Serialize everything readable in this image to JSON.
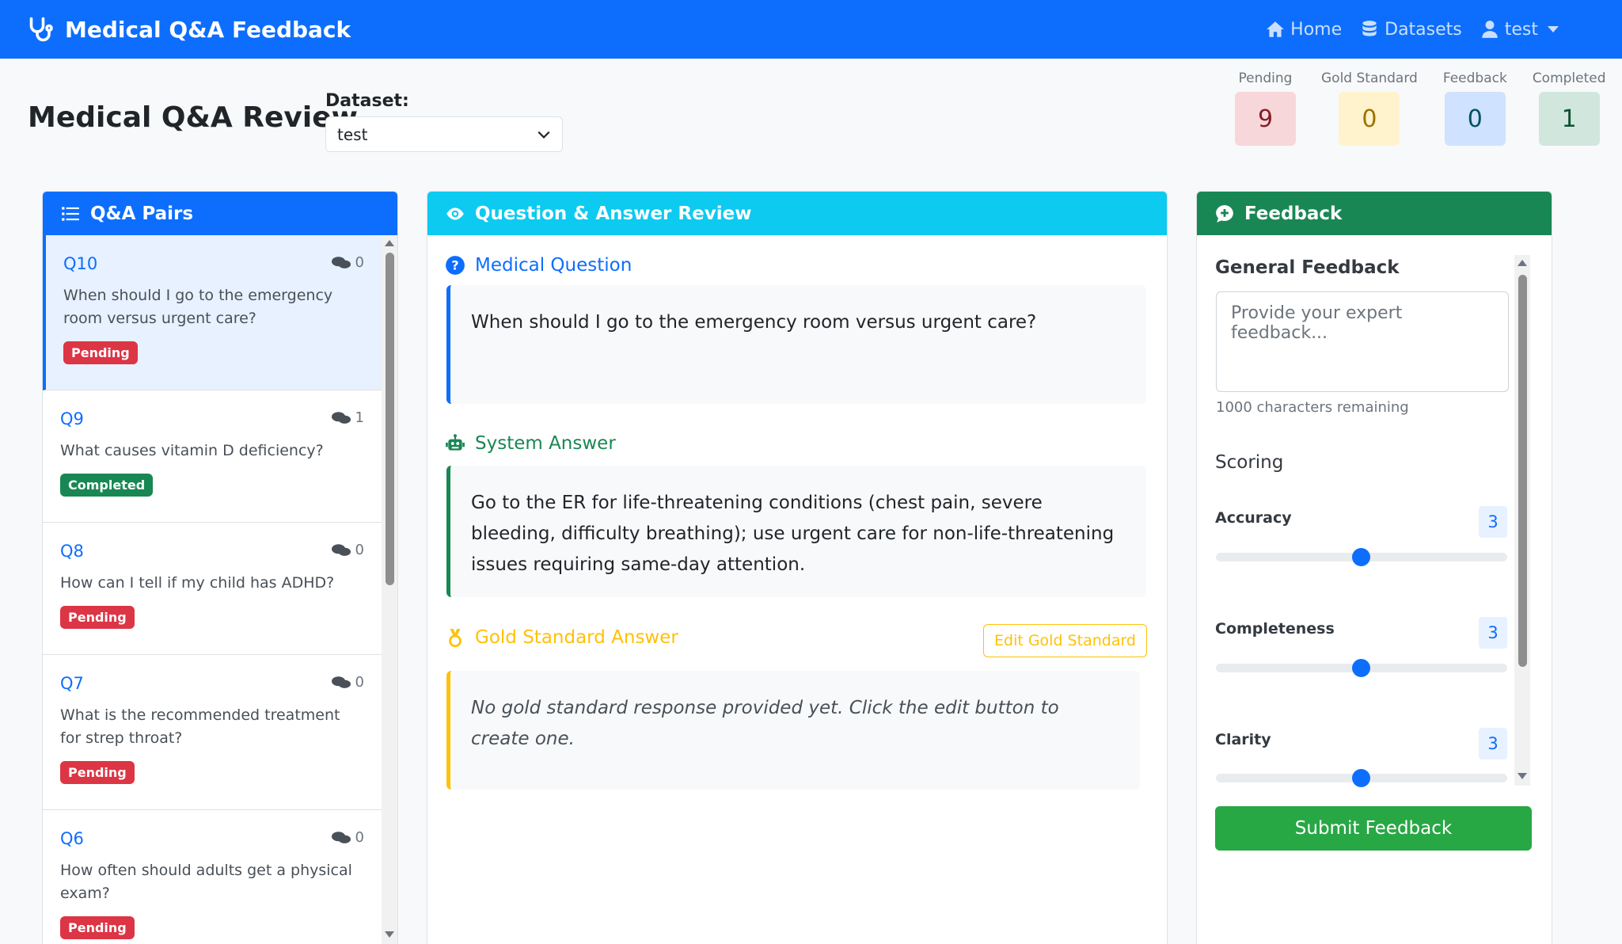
{
  "navbar": {
    "brand": "Medical Q&A Feedback",
    "home": "Home",
    "datasets": "Datasets",
    "user": "test",
    "bg_color": "#0d6efd"
  },
  "header": {
    "title": "Medical Q&A Review",
    "dataset_label": "Dataset:",
    "dataset_value": "test"
  },
  "stats": [
    {
      "label": "Pending",
      "value": "9",
      "bg": "#f8d7da",
      "fg": "#842029"
    },
    {
      "label": "Gold Standard",
      "value": "0",
      "bg": "#fff3cd",
      "fg": "#997404"
    },
    {
      "label": "Feedback",
      "value": "0",
      "bg": "#cfe2ff",
      "fg": "#055160"
    },
    {
      "label": "Completed",
      "value": "1",
      "bg": "#d1e7dd",
      "fg": "#0f5132"
    }
  ],
  "qa_panel": {
    "title": "Q&A Pairs",
    "items": [
      {
        "id": "Q10",
        "count": "0",
        "text": "When should I go to the emergency room versus urgent care?",
        "status": "Pending"
      },
      {
        "id": "Q9",
        "count": "1",
        "text": "What causes vitamin D deficiency?",
        "status": "Completed"
      },
      {
        "id": "Q8",
        "count": "0",
        "text": "How can I tell if my child has ADHD?",
        "status": "Pending"
      },
      {
        "id": "Q7",
        "count": "0",
        "text": "What is the recommended treatment for strep throat?",
        "status": "Pending"
      },
      {
        "id": "Q6",
        "count": "0",
        "text": "How often should adults get a physical exam?",
        "status": "Pending"
      }
    ]
  },
  "review": {
    "title": "Question & Answer Review",
    "question_label": "Medical Question",
    "question": "When should I go to the emergency room versus urgent care?",
    "answer_label": "System Answer",
    "answer": "Go to the ER for life-threatening conditions (chest pain, severe bleeding, difficulty breathing); use urgent care for non-life-threatening issues requiring same-day attention.",
    "gold_label": "Gold Standard Answer",
    "gold_edit": "Edit Gold Standard",
    "gold_text": "No gold standard response provided yet. Click the edit button to create one."
  },
  "feedback": {
    "title": "Feedback",
    "general_label": "General Feedback",
    "placeholder": "Provide your expert feedback...",
    "remaining": "1000 characters remaining",
    "scoring_label": "Scoring",
    "scores": [
      {
        "label": "Accuracy",
        "value": "3",
        "fraction": 0.5
      },
      {
        "label": "Completeness",
        "value": "3",
        "fraction": 0.5
      },
      {
        "label": "Clarity",
        "value": "3",
        "fraction": 0.5
      }
    ],
    "submit": "Submit Feedback"
  },
  "colors": {
    "primary": "#0d6efd",
    "info": "#0dcaf0",
    "success_header": "#198754",
    "success": "#28a745",
    "warning": "#ffc107",
    "danger": "#dc3545"
  }
}
